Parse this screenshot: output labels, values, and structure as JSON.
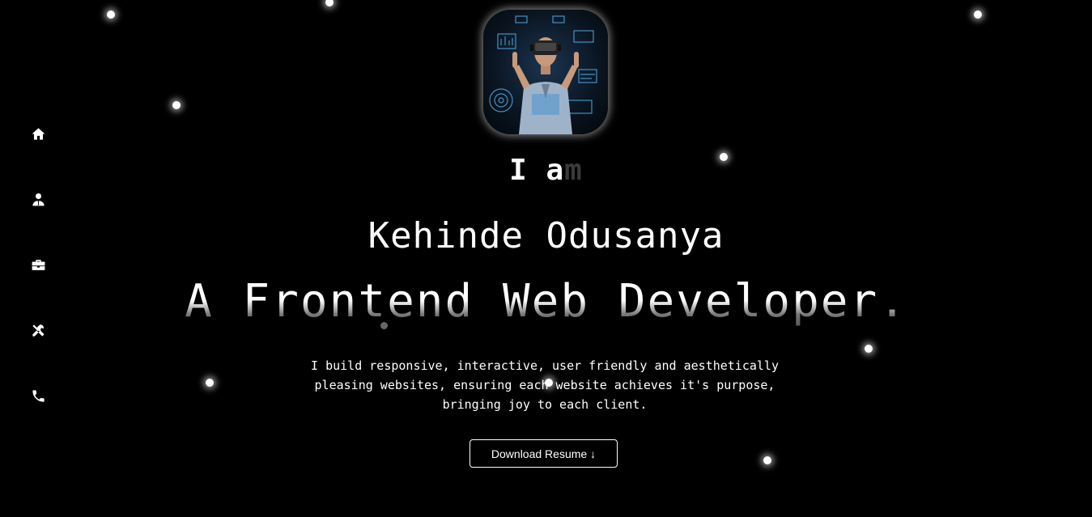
{
  "hero": {
    "intro_solid": "I a",
    "intro_faded": "m",
    "name": "Kehinde Odusanya",
    "role": "A Frontend Web Developer.",
    "bio": "I build responsive, interactive, user friendly and aesthetically pleasing websites, ensuring each website achieves it's purpose, bringing joy to each client.",
    "resume_label": "Download Resume ↓"
  },
  "nav": {
    "items": [
      {
        "icon": "home-icon"
      },
      {
        "icon": "user-icon"
      },
      {
        "icon": "briefcase-icon"
      },
      {
        "icon": "tools-icon"
      },
      {
        "icon": "phone-icon"
      }
    ]
  },
  "avatar": {
    "icon": "vr-developer-avatar"
  },
  "colors": {
    "background": "#000000",
    "text": "#ffffff"
  }
}
